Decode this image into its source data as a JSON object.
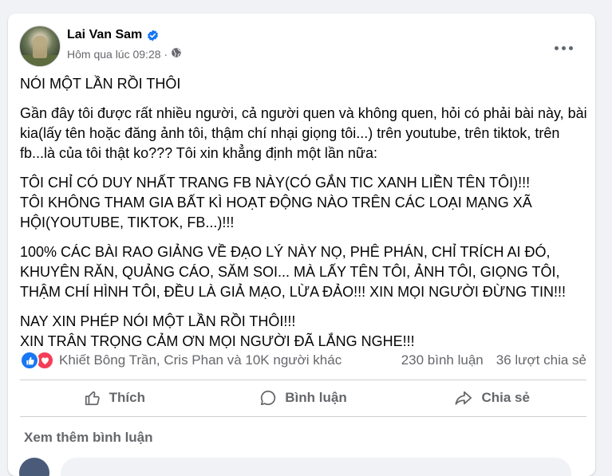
{
  "post": {
    "author": "Lai Van Sam",
    "verified": true,
    "timestamp": "Hôm qua lúc 09:28",
    "separator": "·",
    "privacy_icon": "globe-icon",
    "more_icon": "more-horizontal-icon",
    "paragraphs": [
      "NÓI MỘT LẦN RỒI THÔI",
      "Gần đây tôi được rất nhiều người, cả người quen và không quen, hỏi có phải bài này, bài kia(lấy tên hoặc đăng ảnh tôi, thậm chí nhại giọng tôi...) trên youtube, trên tiktok, trên fb...là của tôi thật ko??? Tôi xin khẳng định một lần nữa:",
      "TÔI CHỈ CÓ DUY NHẤT TRANG FB NÀY(CÓ GẮN TIC XANH LIỀN TÊN TÔI)!!!",
      "TÔI KHÔNG THAM GIA BẤT KÌ HOẠT ĐỘNG NÀO TRÊN CÁC LOẠI MẠNG XÃ HỘI(YOUTUBE, TIKTOK, FB...)!!!",
      "100% CÁC BÀI RAO GIẢNG VỀ ĐẠO LÝ NÀY NỌ, PHÊ PHÁN, CHỈ TRÍCH AI ĐÓ, KHUYÊN RĂN, QUẢNG CÁO, SĂM SOI... MÀ LẤY TÊN TÔI, ẢNH TÔI, GIỌNG TÔI, THẬM CHÍ HÌNH TÔI, ĐỀU LÀ GIẢ MẠO, LỪA ĐẢO!!! XIN MỌI NGƯỜI ĐỪNG TIN!!!",
      "NAY XIN PHÉP NÓI MỘT LẦN RỒI THÔI!!!",
      "XIN TRÂN TRỌNG CẢM ƠN MỌI NGƯỜI ĐÃ LẮNG NGHE!!!"
    ]
  },
  "reactions": {
    "icons": [
      "like-reaction-icon",
      "love-reaction-icon"
    ],
    "names": "Khiết Bông Trần, Cris Phan và 10K người khác",
    "comments": "230 bình luận",
    "shares": "36 lượt chia sẻ"
  },
  "actions": {
    "like": "Thích",
    "comment": "Bình luận",
    "share": "Chia sẻ"
  },
  "comments": {
    "more_label": "Xem thêm bình luận"
  },
  "colors": {
    "page_bg": "#f0f2f5",
    "card_bg": "#ffffff",
    "text_primary": "#050505",
    "text_secondary": "#65676b",
    "like_blue": "#1877f2",
    "love_red": "#f33e58",
    "divider": "#ced0d4"
  }
}
